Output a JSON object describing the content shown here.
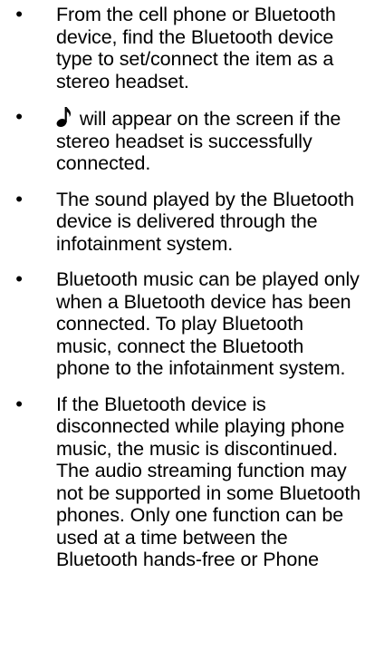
{
  "bullet_symbol": "•",
  "items": [
    {
      "text": "From the cell phone or Bluetooth device, find the Bluetooth device type to set/connect the item as a stereo headset."
    },
    {
      "icon": "music-note-icon",
      "text": "will appear on the screen if the stereo headset is successfully connected."
    },
    {
      "text": "The sound played by the Bluetooth device is delivered through the infotainment system."
    },
    {
      "text": "Bluetooth music can be played only when a Bluetooth device has been connected. To play Bluetooth music, connect the Bluetooth phone to the infotainment system."
    },
    {
      "text": "If the Bluetooth device is disconnected while playing phone music, the music is discontinued. The audio streaming function may not be supported in some Bluetooth phones. Only one function can be used at a time between the Bluetooth hands-free or Phone"
    }
  ]
}
